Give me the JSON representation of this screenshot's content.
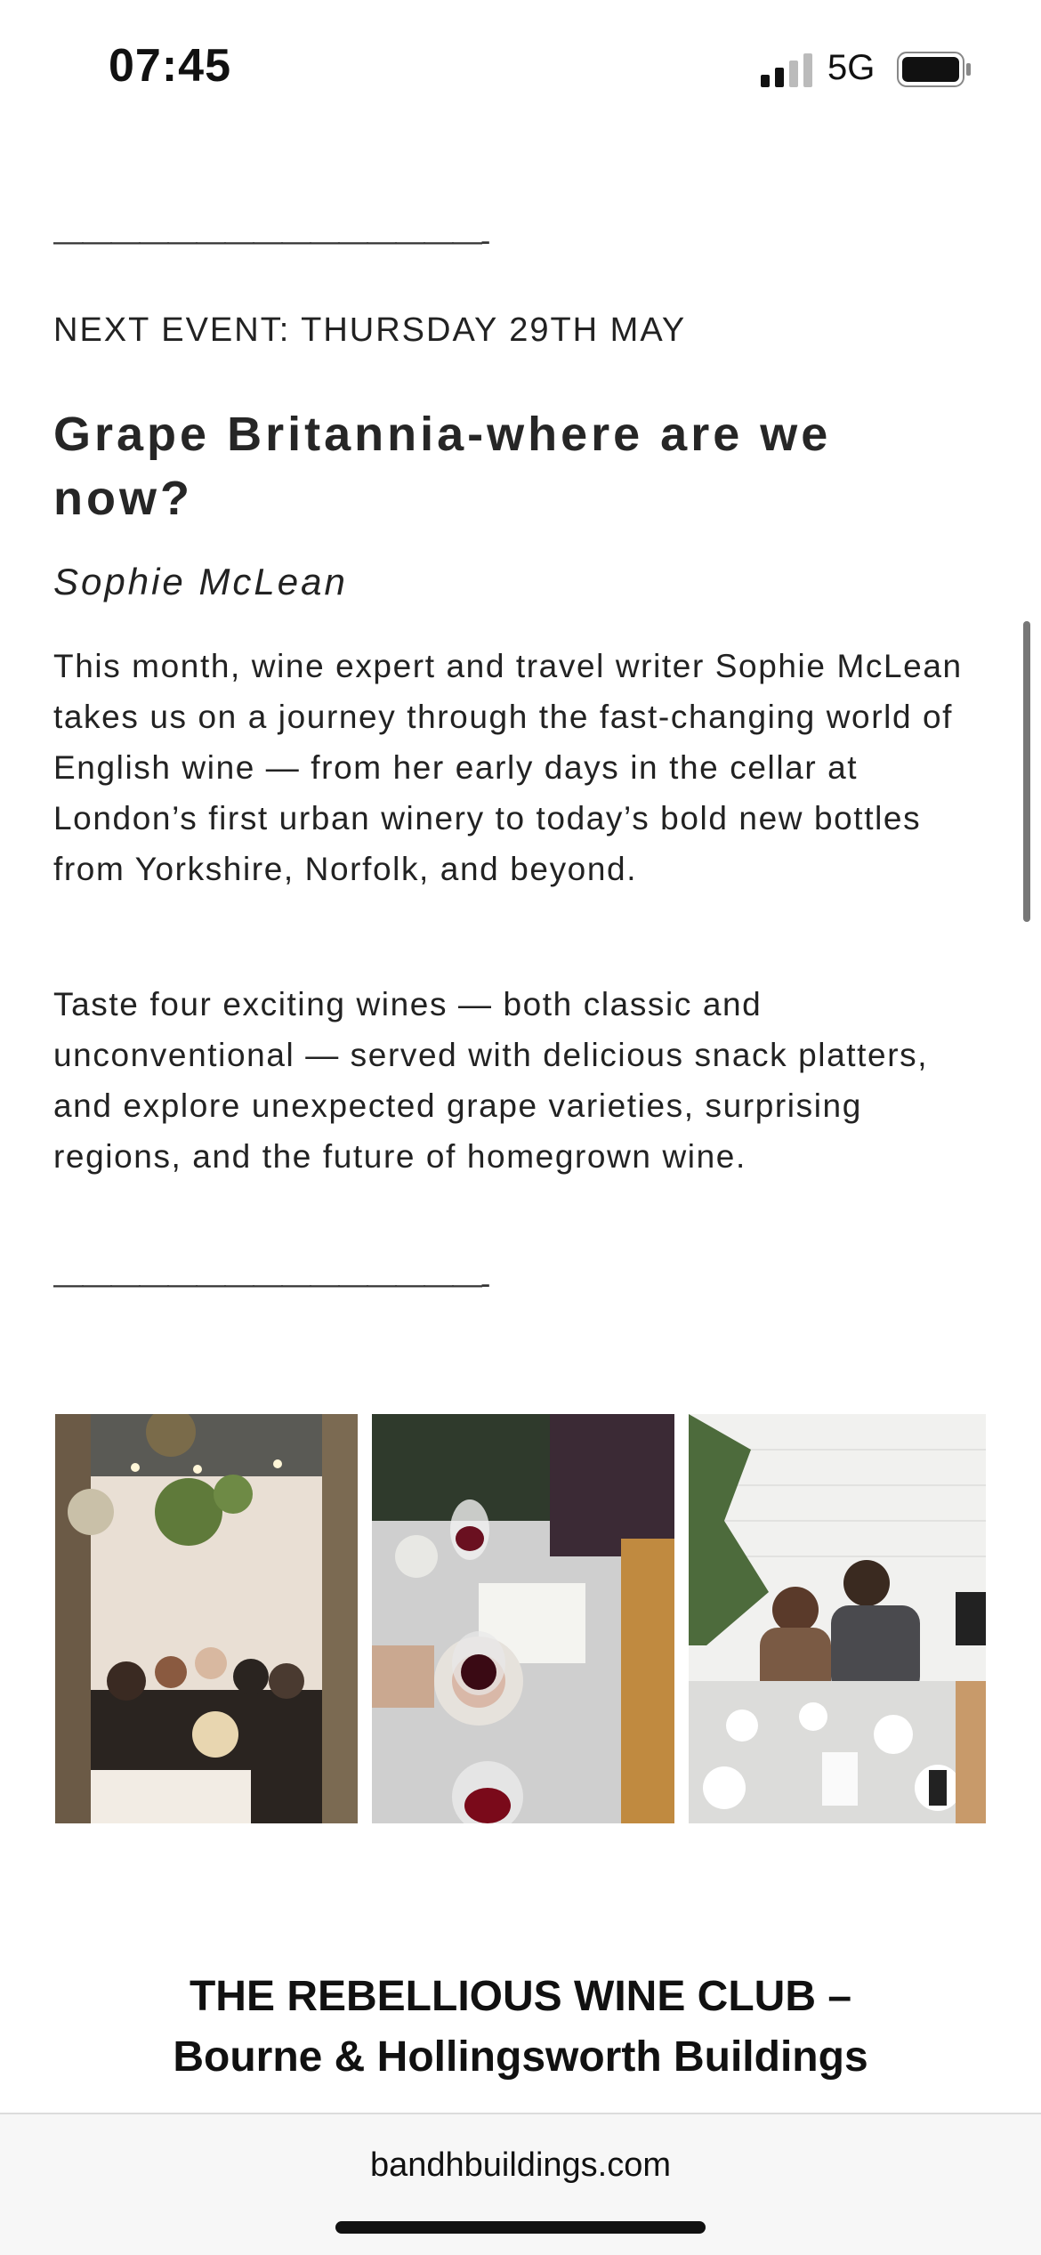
{
  "status_bar": {
    "time": "07:45",
    "network": "5G",
    "icons": [
      "signal-icon",
      "battery-icon"
    ]
  },
  "article": {
    "divider_top": "———————————————-",
    "next_event": "NEXT EVENT: THURSDAY 29TH MAY",
    "title": "Grape Britannia-where are we now?",
    "author": "Sophie McLean",
    "paragraph_1": "This month, wine expert and travel writer Sophie McLean takes us on a journey through the fast-changing world of English wine — from her early days in the cellar at London’s first urban winery to today’s bold new bottles from Yorkshire, Norfolk, and beyond.",
    "paragraph_2": "Taste four exciting wines — both classic and unconventional — served with delicious snack platters, and explore unexpected grape varieties, surprising regions, and the future of homegrown wine.",
    "divider_bottom": "———————————————-"
  },
  "gallery": {
    "photos": [
      "group-dinner-photo",
      "wine-glasses-photo",
      "couple-tasting-photo"
    ]
  },
  "venue": {
    "line_1": "THE REBELLIOUS WINE CLUB –",
    "line_2": "Bourne & Hollingsworth Buildings"
  },
  "browser": {
    "url": "bandhbuildings.com"
  }
}
